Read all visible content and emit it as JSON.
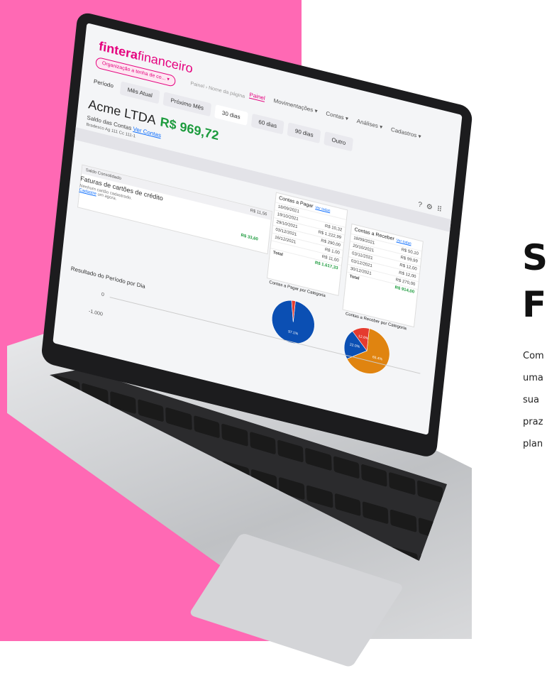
{
  "colors": {
    "panel_pink": "#ff69b4",
    "brand_pink": "#e5007e",
    "positive_green": "#1c9b3d",
    "pie_blue": "#0b4fb3",
    "pie_red": "#e53b2f",
    "pie_orange": "#e08410"
  },
  "headline": [
    "Se",
    "Fi"
  ],
  "subtext": [
    "Com",
    "uma",
    "sua",
    "praz",
    "plan"
  ],
  "app": {
    "brand_bold": "fintera",
    "brand_light": "financeiro",
    "org_select": "Organização a tenha de co... ▾",
    "breadcrumb": "Painel  ›  Nome da página",
    "nav": [
      "Painel",
      "Movimentações ▾",
      "Contas ▾",
      "Análises ▾",
      "Cadastros ▾"
    ],
    "period_label": "Período",
    "period_tabs": [
      "Mês Atual",
      "Próximo Mês",
      "30 dias",
      "60 dias",
      "90 dias",
      "Outro"
    ],
    "company": "Acme LTDA",
    "balance": "R$ 969,72",
    "saldo_label": "Saldo das Contas",
    "saldo_link": "Ver Contas",
    "bank": "Bradesco Ag 111 Cc 111-1",
    "header_icons": [
      "help-icon",
      "settings-icon",
      "apps-icon"
    ],
    "consolidado": {
      "label": "Saldo Consolidado",
      "value": "R$ 11,56"
    },
    "faturas": {
      "title": "Faturas de cartões de crédito",
      "note": "Nenhum cartão cadastrado.",
      "link": "Cadastre",
      "note_tail": "um agora.",
      "value": "R$ 33,60"
    },
    "pagar": {
      "title": "Contas a Pagar",
      "link": "Ver todas",
      "rows": [
        [
          "18/09/2021",
          ""
        ],
        [
          "19/10/2021",
          "R$ 10,32"
        ],
        [
          "29/10/2021",
          "R$ 1.222,99"
        ],
        [
          "03/12/2021",
          "R$ 290,00"
        ],
        [
          "16/12/2021",
          "R$ 1,00"
        ],
        [
          "",
          "R$ 11,00"
        ]
      ],
      "total_label": "Total",
      "total": "R$ 1.617,33"
    },
    "receber": {
      "title": "Contas a Receber",
      "link": "Ver todas",
      "rows": [
        [
          "18/09/2021",
          "R$ 50,10"
        ],
        [
          "20/10/2021",
          "R$ 99,99"
        ],
        [
          "03/11/2021",
          "R$ 12,00"
        ],
        [
          "03/12/2021",
          "R$ 12,00"
        ],
        [
          "30/12/2021",
          "R$ 270,00"
        ]
      ],
      "total_label": "Total",
      "total": "R$ 914,00"
    },
    "pagar_cat_title": "Contas a Pagar por Categoria",
    "receber_cat_title": "Contas a Receber por Categoria",
    "pagar_pie": {
      "label": "97.1%",
      "slices": [
        97.1,
        2.9
      ]
    },
    "receber_pie": {
      "labels": [
        "65.4%",
        "22.0%",
        "12.6%"
      ],
      "slices": [
        65.4,
        22.0,
        12.6
      ]
    },
    "resultado_title": "Resultado do Período por Dia",
    "axis_zero": "0",
    "axis_neg": "-1.000"
  }
}
